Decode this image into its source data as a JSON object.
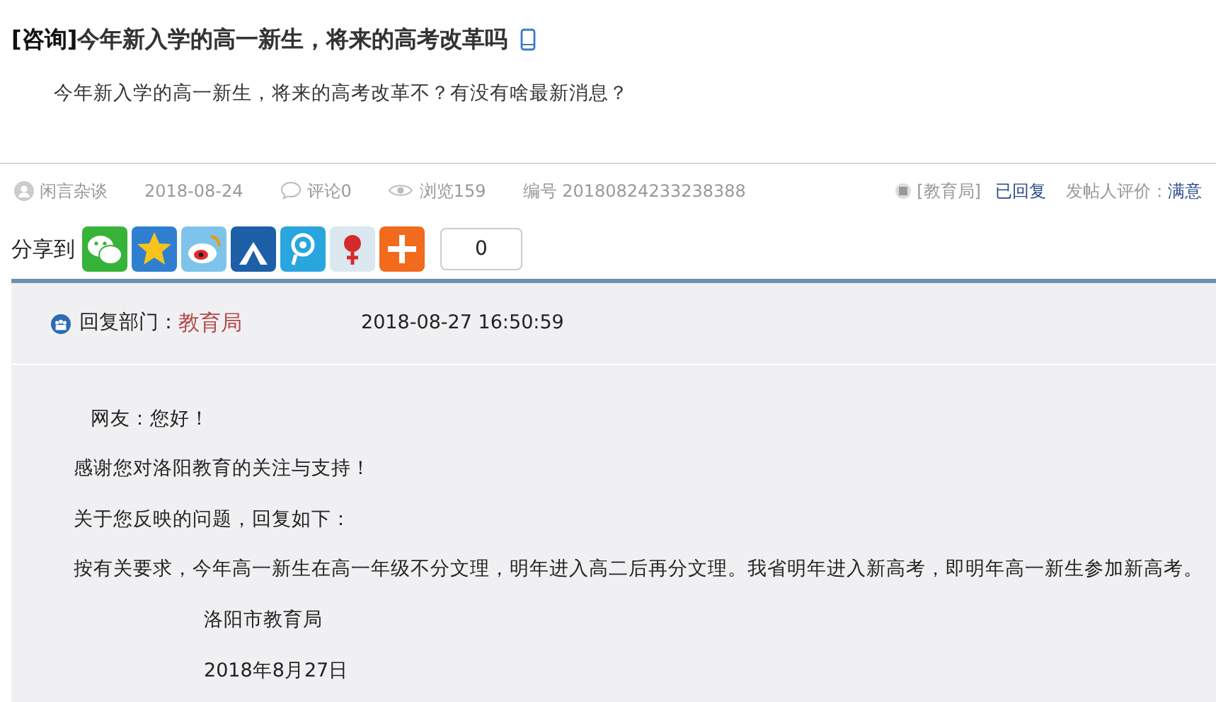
{
  "post": {
    "tag": "[咨询]",
    "title": "今年新入学的高一新生，将来的高考改革吗",
    "question": "今年新入学的高一新生，将来的高考改革不？有没有啥最新消息？"
  },
  "meta": {
    "author": "闲言杂谈",
    "date": "2018-08-24",
    "comments": "评论0",
    "views": "浏览159",
    "number": "编号 20180824233238388",
    "department": "[教育局]",
    "status": "已回复",
    "rating_label": "发帖人评价：",
    "rating": "满意"
  },
  "share": {
    "label": "分享到",
    "buttons": [
      {
        "kind": "wechat"
      },
      {
        "kind": "qzone"
      },
      {
        "kind": "weibo"
      },
      {
        "kind": "renren"
      },
      {
        "kind": "pengyou"
      },
      {
        "kind": "tencent"
      },
      {
        "kind": "more"
      }
    ],
    "count": "0"
  },
  "reply": {
    "department_label": "回复部门：",
    "department": "教育局",
    "time": "2018-08-27 16:50:59",
    "paragraphs": [
      {
        "kind": "greeting",
        "text": "网友：您好！"
      },
      {
        "kind": "body",
        "text": "感谢您对洛阳教育的关注与支持！"
      },
      {
        "kind": "body",
        "text": "关于您反映的问题，回复如下："
      },
      {
        "kind": "body",
        "text": "按有关要求，今年高一新生在高一年级不分文理，明年进入高二后再分文理。我省明年进入新高考，即明年高一新生参加新高考。"
      },
      {
        "kind": "signature",
        "text": "洛阳市教育局"
      },
      {
        "kind": "signature",
        "text": "2018年8月27日"
      }
    ]
  }
}
